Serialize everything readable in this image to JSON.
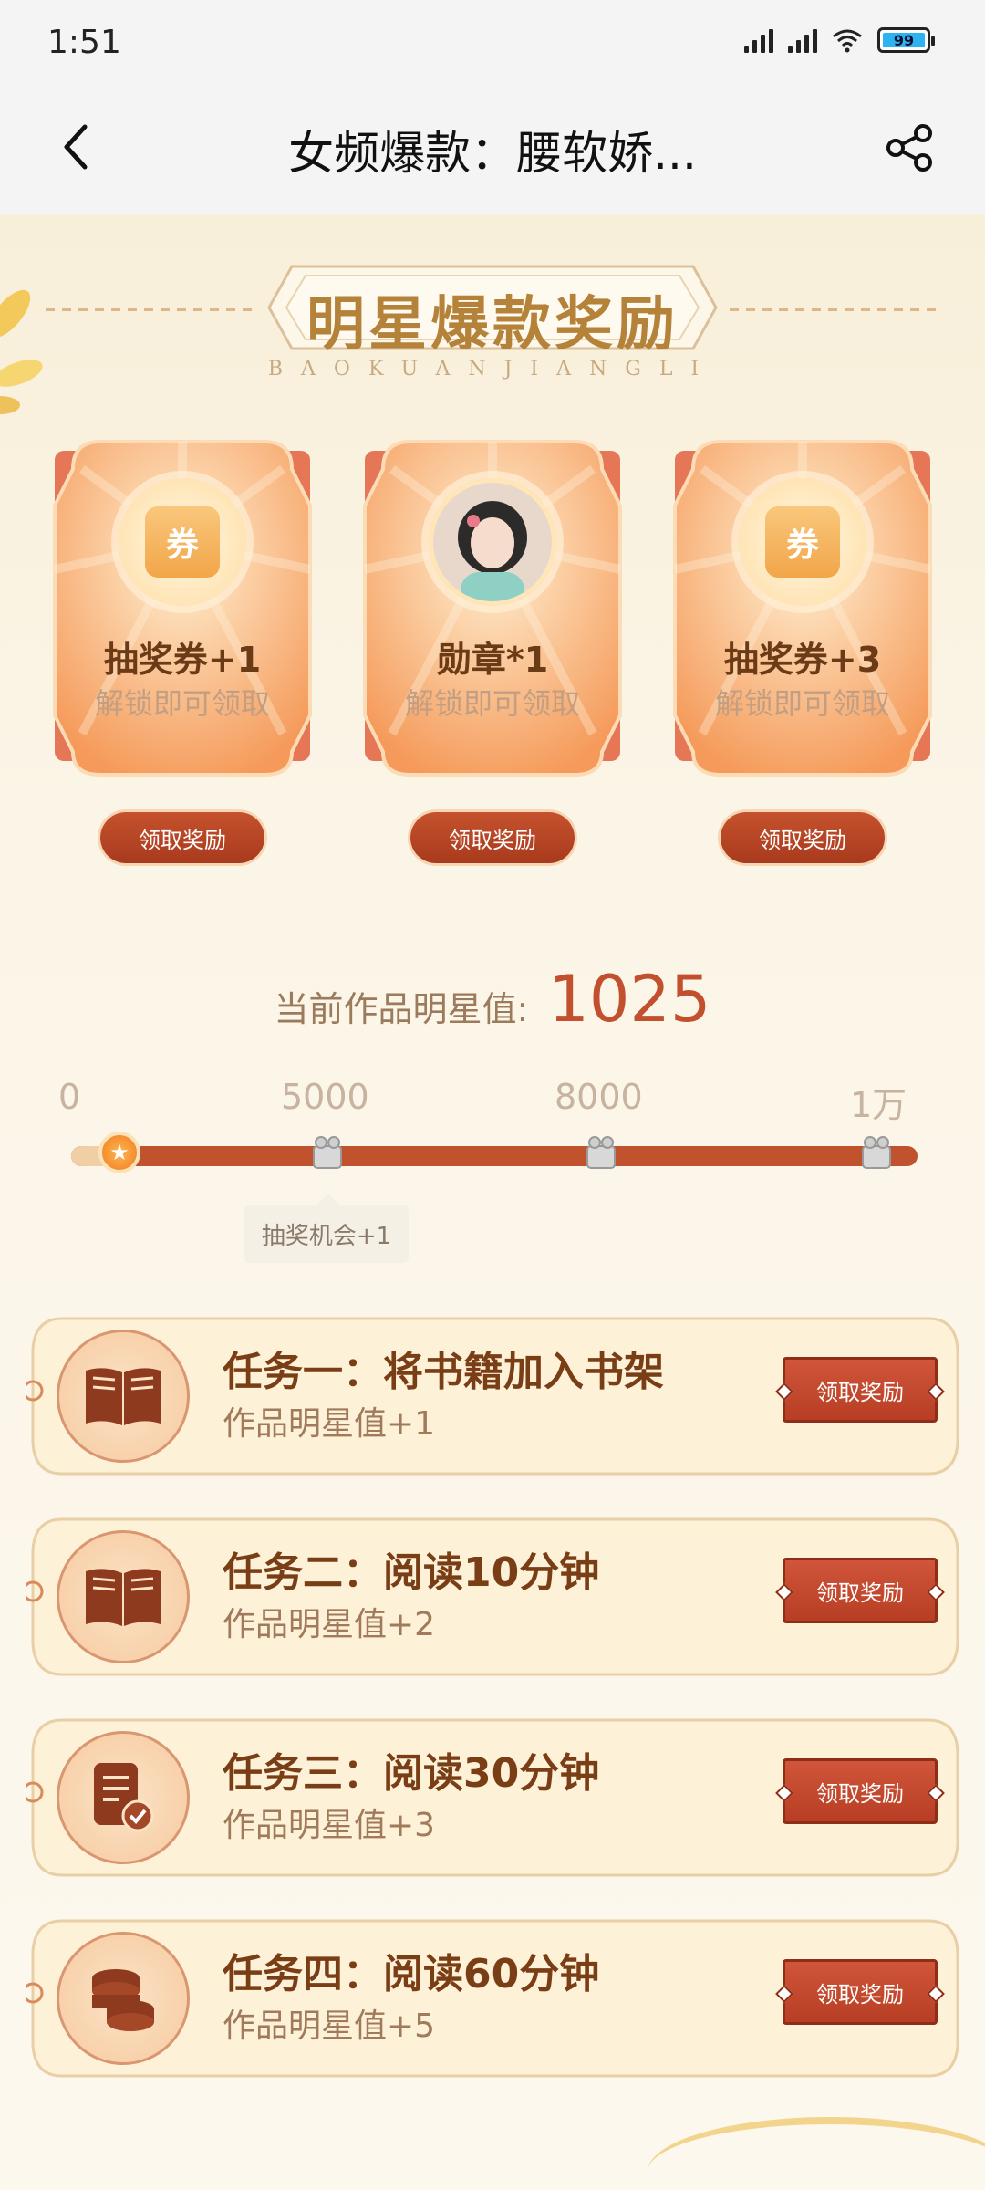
{
  "status": {
    "time": "1:51",
    "battery": "99"
  },
  "nav": {
    "title": "女频爆款：腰软娇..."
  },
  "header": {
    "title": "明星爆款奖励",
    "subtitle": "BAOKUANJIANGLI"
  },
  "rewards": [
    {
      "name": "抽奖券+1",
      "sub": "解锁即可领取",
      "icon_text": "券",
      "button": "领取奖励"
    },
    {
      "name": "勋章*1",
      "sub": "解锁即可领取",
      "button": "领取奖励"
    },
    {
      "name": "抽奖券+3",
      "sub": "解锁即可领取",
      "icon_text": "券",
      "button": "领取奖励"
    }
  ],
  "star_value": {
    "label": "当前作品明星值:",
    "value": "1025"
  },
  "milestones": [
    "0",
    "5000",
    "8000",
    "1万"
  ],
  "progress": {
    "current": 1025,
    "max": 10000
  },
  "tooltip": "抽奖机会+1",
  "tasks": [
    {
      "title": "任务一：将书籍加入书架",
      "sub": "作品明星值+1",
      "button": "领取奖励",
      "icon": "open-book-icon"
    },
    {
      "title": "任务二：阅读10分钟",
      "sub": "作品明星值+2",
      "button": "领取奖励",
      "icon": "open-book-icon"
    },
    {
      "title": "任务三：阅读30分钟",
      "sub": "作品明星值+3",
      "button": "领取奖励",
      "icon": "document-check-icon"
    },
    {
      "title": "任务四：阅读60分钟",
      "sub": "作品明星值+5",
      "button": "领取奖励",
      "icon": "coin-stack-icon"
    }
  ],
  "colors": {
    "accent": "#c2502e",
    "button": "#b73e24",
    "gold": "#b5823a",
    "bg": "#fbf6ea"
  }
}
